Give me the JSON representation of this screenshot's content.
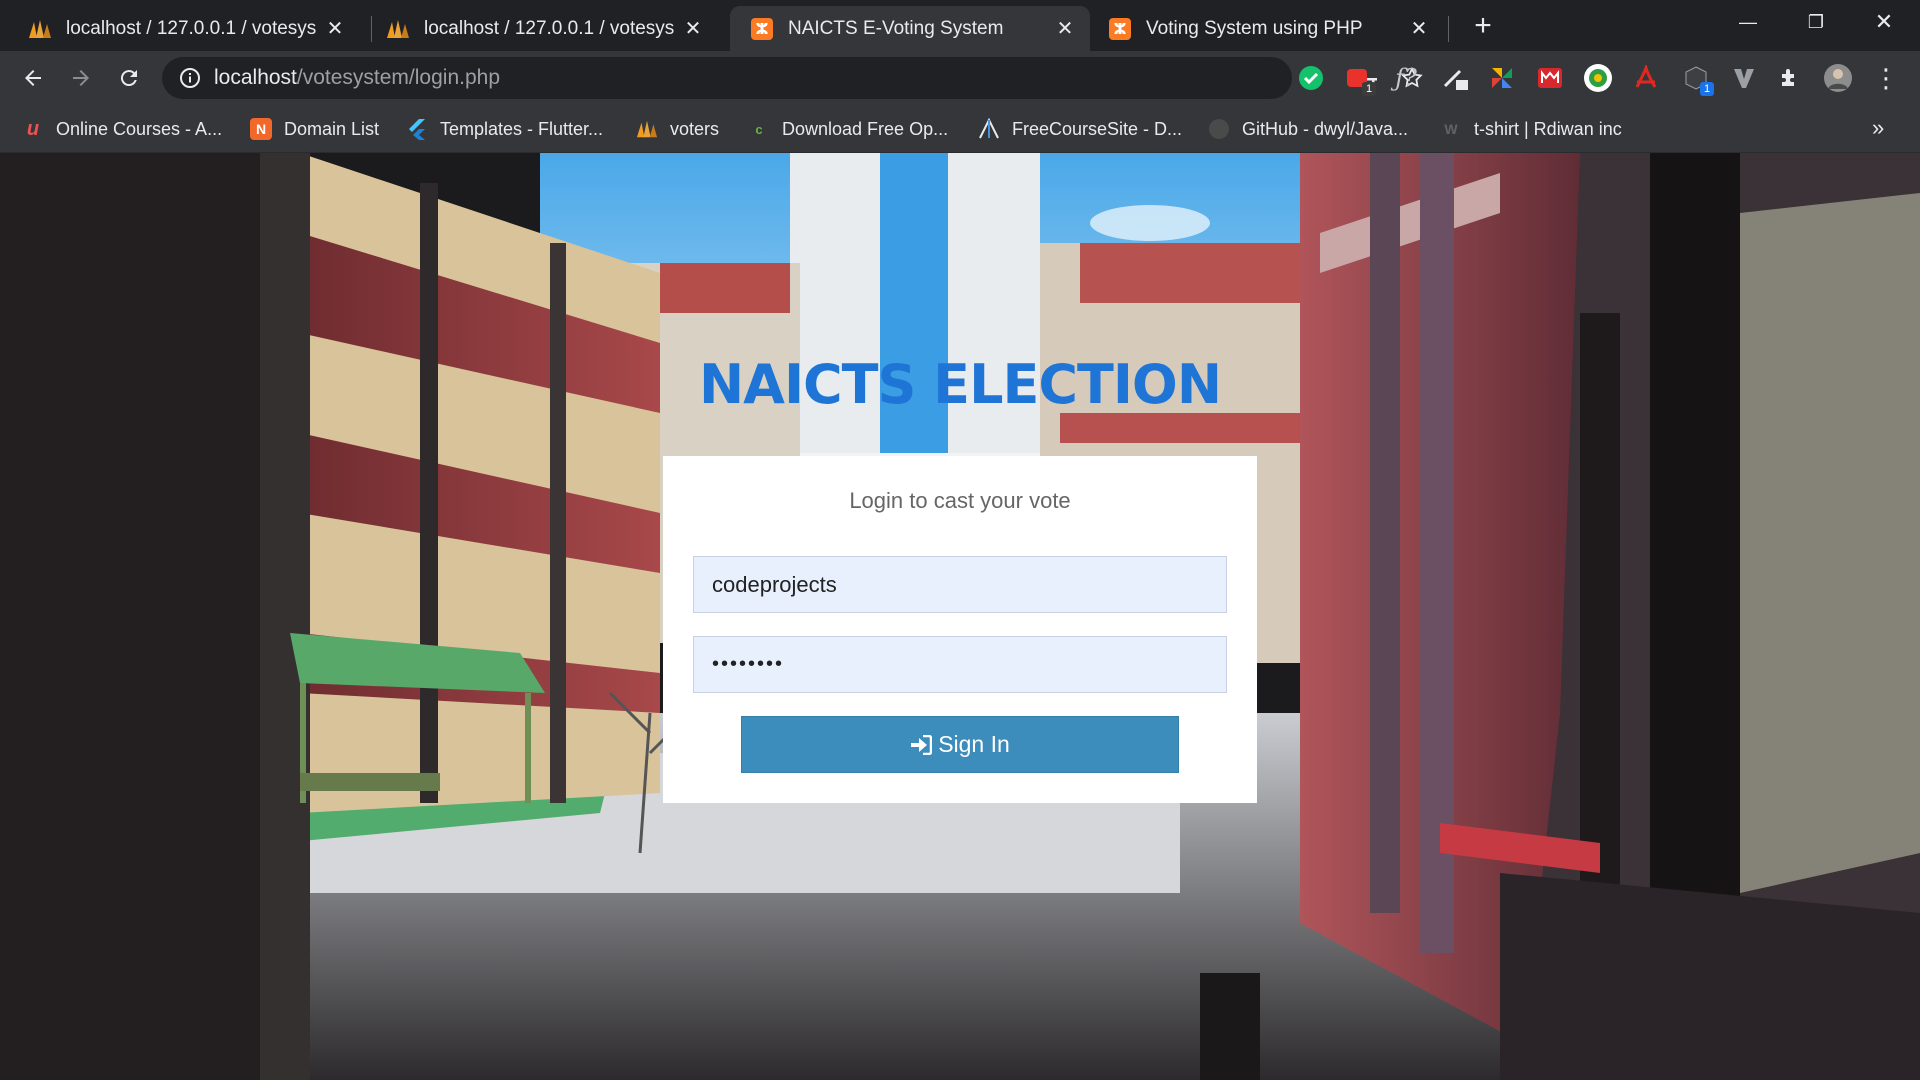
{
  "tabs": [
    {
      "title": "localhost / 127.0.0.1 / votesystem",
      "icon": "phpmyadmin-icon",
      "active": false
    },
    {
      "title": "localhost / 127.0.0.1 / votesystem",
      "icon": "phpmyadmin-icon",
      "active": false
    },
    {
      "title": "NAICTS E-Voting System",
      "icon": "xampp-icon",
      "active": true
    },
    {
      "title": "Voting System using PHP",
      "icon": "xampp-icon",
      "active": false
    }
  ],
  "toolbar": {
    "url_host": "localhost",
    "url_path": "/votesystem/login.php"
  },
  "bookmarks": [
    {
      "label": "Online Courses - A...",
      "icon": "udemy-icon"
    },
    {
      "label": "Domain List",
      "icon": "domain-icon"
    },
    {
      "label": "Templates - Flutter...",
      "icon": "flutter-icon"
    },
    {
      "label": "voters",
      "icon": "phpmyadmin-icon"
    },
    {
      "label": "Download Free Op...",
      "icon": "c-icon"
    },
    {
      "label": "FreeCourseSite - D...",
      "icon": "freecoursesite-icon"
    },
    {
      "label": "GitHub - dwyl/Java...",
      "icon": "github-icon"
    },
    {
      "label": "t-shirt | Rdiwan inc",
      "icon": "w-icon"
    }
  ],
  "page": {
    "heading": "NAICTS ELECTION",
    "login_message": "Login to cast your vote",
    "username_value": "codeprojects",
    "password_mask": "••••••••",
    "signin_label": "Sign In"
  },
  "colors": {
    "heading": "#1f75d6",
    "signin_button": "#3c8dbc",
    "input_autofill": "#e8f0fe"
  }
}
